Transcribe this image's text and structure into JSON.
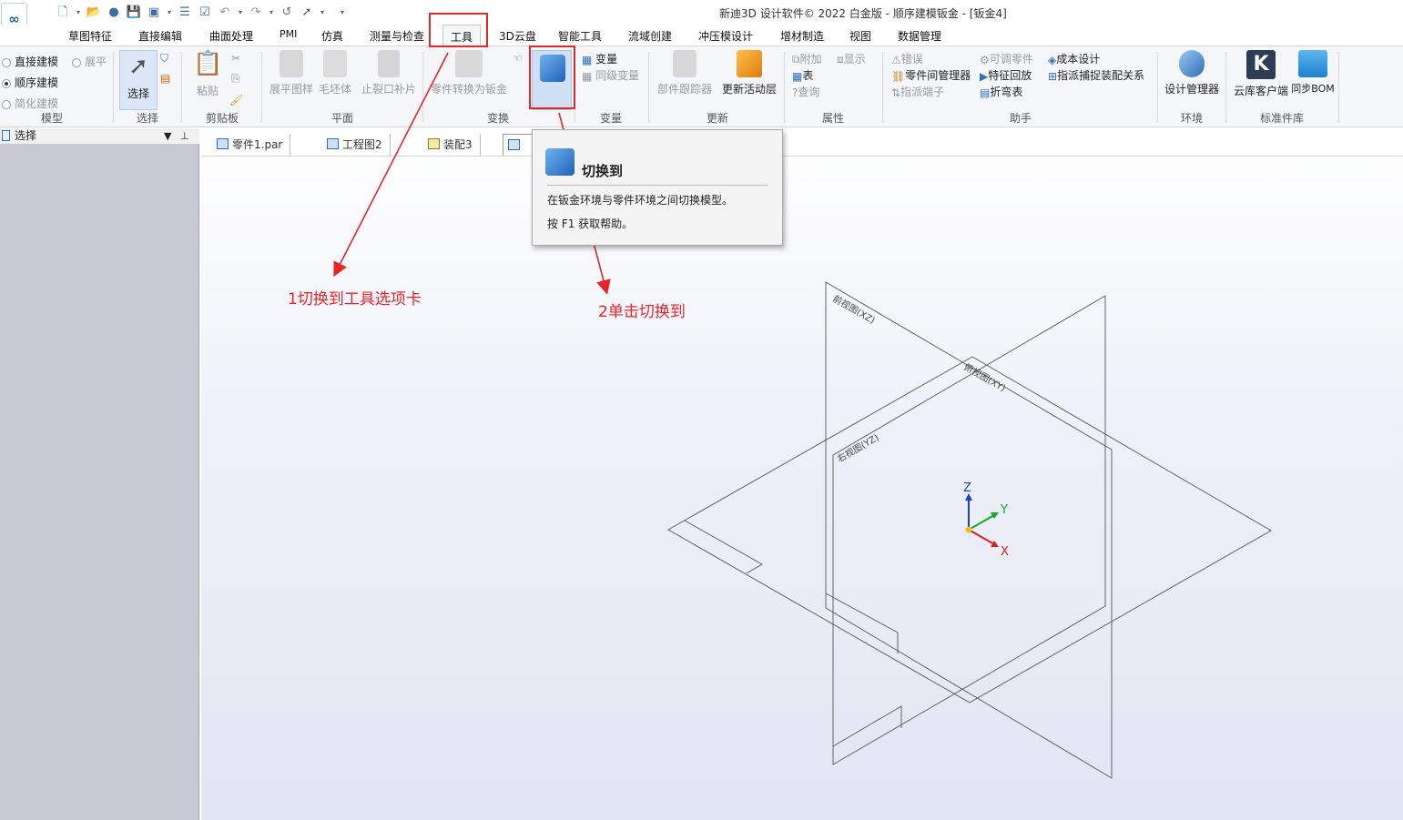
{
  "window": {
    "title": "新迪3D 设计软件© 2022 白金版 - 顺序建模钣金 - [钣金4]",
    "logo": "∞"
  },
  "ribbon_tabs": [
    "草图特征",
    "直接编辑",
    "曲面处理",
    "PMI",
    "仿真",
    "测量与检查",
    "工具",
    "3D云盘",
    "智能工具",
    "流域创建",
    "冲压模设计",
    "增材制造",
    "视图",
    "数据管理"
  ],
  "active_tab": "工具",
  "groups": {
    "model": {
      "label": "模型",
      "direct": "直接建模",
      "flat": "展平",
      "sequential": "顺序建模",
      "simplified": "简化建模"
    },
    "select": {
      "label": "选择",
      "button": "选择"
    },
    "clipboard": {
      "label": "剪贴板",
      "paste": "粘贴"
    },
    "plane": {
      "label": "平面",
      "flatten_pattern": "展平图样",
      "blank": "毛坯体",
      "relief": "止裂口补片"
    },
    "transform": {
      "label": "变换",
      "part_to_sheet": "零件转换为钣金"
    },
    "variable": {
      "label": "变量",
      "var": "变量",
      "peer_var": "同级变量"
    },
    "update": {
      "label": "更新",
      "tracker": "部件跟踪器",
      "update_layer": "更新活动层"
    },
    "props": {
      "label": "属性",
      "attach": "附加",
      "show": "显示",
      "table": "表",
      "query": "查询"
    },
    "helper": {
      "label": "助手",
      "error": "错误",
      "adjustable": "可调零件",
      "cost": "成本设计",
      "part_mgr": "零件间管理器",
      "feature_playback": "特征回放",
      "capture": "指派捕捉装配关系",
      "assign_terminal": "指派端子",
      "bend_table": "折弯表"
    },
    "env": {
      "label": "环境",
      "design_mgr": "设计管理器"
    },
    "stdlib": {
      "label": "标准件库",
      "cloud": "云库客户端",
      "sync_bom": "同步BOM"
    }
  },
  "left_pane": {
    "title": "选择"
  },
  "doc_tabs": [
    "零件1.par",
    "工程图2",
    "装配3"
  ],
  "tooltip": {
    "title": "切换到",
    "desc": "在钣金环境与零件环境之间切换模型。",
    "help": "按 F1 获取帮助。"
  },
  "annotations": {
    "step1": "1切换到工具选项卡",
    "step2": "2单击切换到"
  },
  "planes": {
    "front": "前视图(XZ)",
    "top": "俯视图(XY)",
    "right": "右视图(YZ)"
  },
  "axes": {
    "x": "X",
    "y": "Y",
    "z": "Z"
  },
  "colors": {
    "annotation": "#e8242b",
    "axis_x": "#d62020",
    "axis_y": "#17a826",
    "axis_z": "#1f3fc9"
  }
}
